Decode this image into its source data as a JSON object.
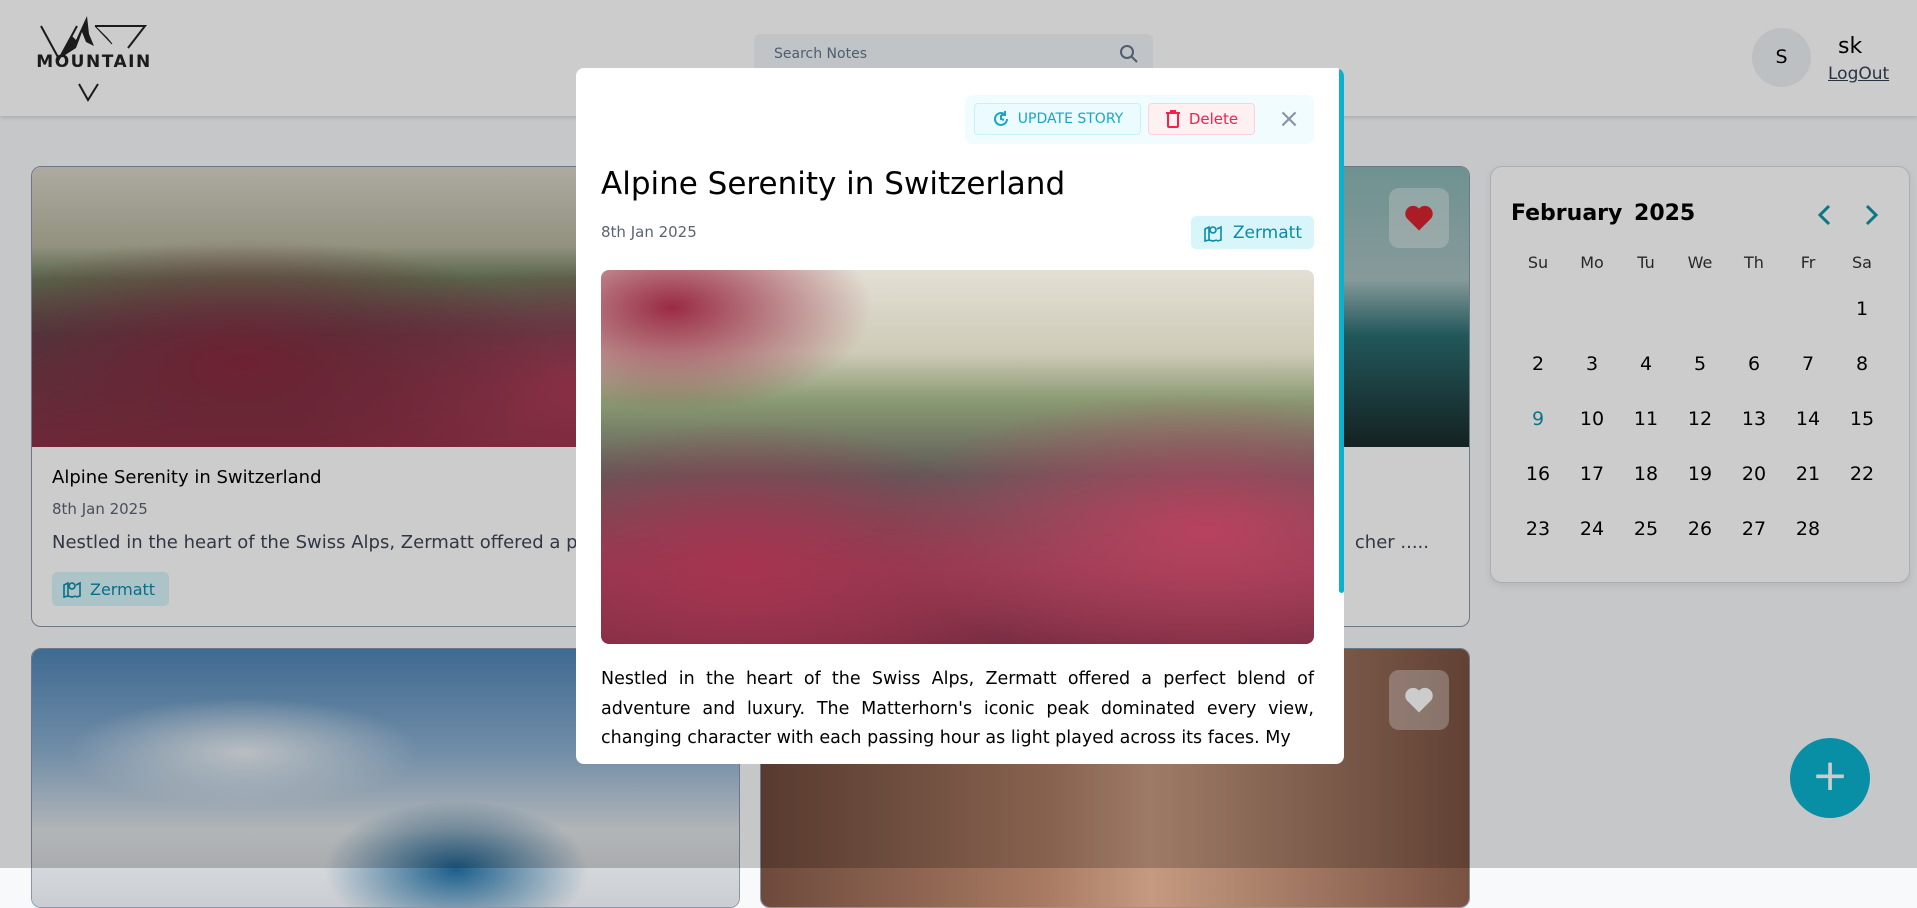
{
  "header": {
    "logo_text": "MOUNTAIN",
    "search_placeholder": "Search Notes",
    "user_initial": "S",
    "user_name": "sk",
    "logout_label": "LogOut"
  },
  "cards": [
    {
      "title": "Alpine Serenity in Switzerland",
      "date": "8th Jan 2025",
      "description": "Nestled in the heart of the Swiss Alps, Zermatt offered a perf",
      "location": "Zermatt",
      "favorite": true
    },
    {
      "description": "cher .....",
      "favorite": true
    },
    {
      "favorite": false
    },
    {
      "favorite": false
    }
  ],
  "calendar": {
    "month_year": "February 2025",
    "weekdays": [
      "Su",
      "Mo",
      "Tu",
      "We",
      "Th",
      "Fr",
      "Sa"
    ],
    "days": [
      "",
      "",
      "",
      "",
      "",
      "",
      "1",
      "2",
      "3",
      "4",
      "5",
      "6",
      "7",
      "8",
      "9",
      "10",
      "11",
      "12",
      "13",
      "14",
      "15",
      "16",
      "17",
      "18",
      "19",
      "20",
      "21",
      "22",
      "23",
      "24",
      "25",
      "26",
      "27",
      "28"
    ],
    "today": "9"
  },
  "fab": {
    "label": "+"
  },
  "modal": {
    "update_label": "UPDATE STORY",
    "delete_label": "Delete",
    "close_label": "×",
    "title": "Alpine Serenity in Switzerland",
    "date": "8th Jan 2025",
    "location": "Zermatt",
    "body": "Nestled in the heart of the Swiss Alps, Zermatt offered a perfect blend of adventure and luxury. The Matterhorn's iconic peak dominated every view, changing character with each passing hour as light played across its faces. My"
  },
  "colors": {
    "accent": "#0ab2cf",
    "danger": "#f3214b",
    "heart": "#d8232f"
  }
}
